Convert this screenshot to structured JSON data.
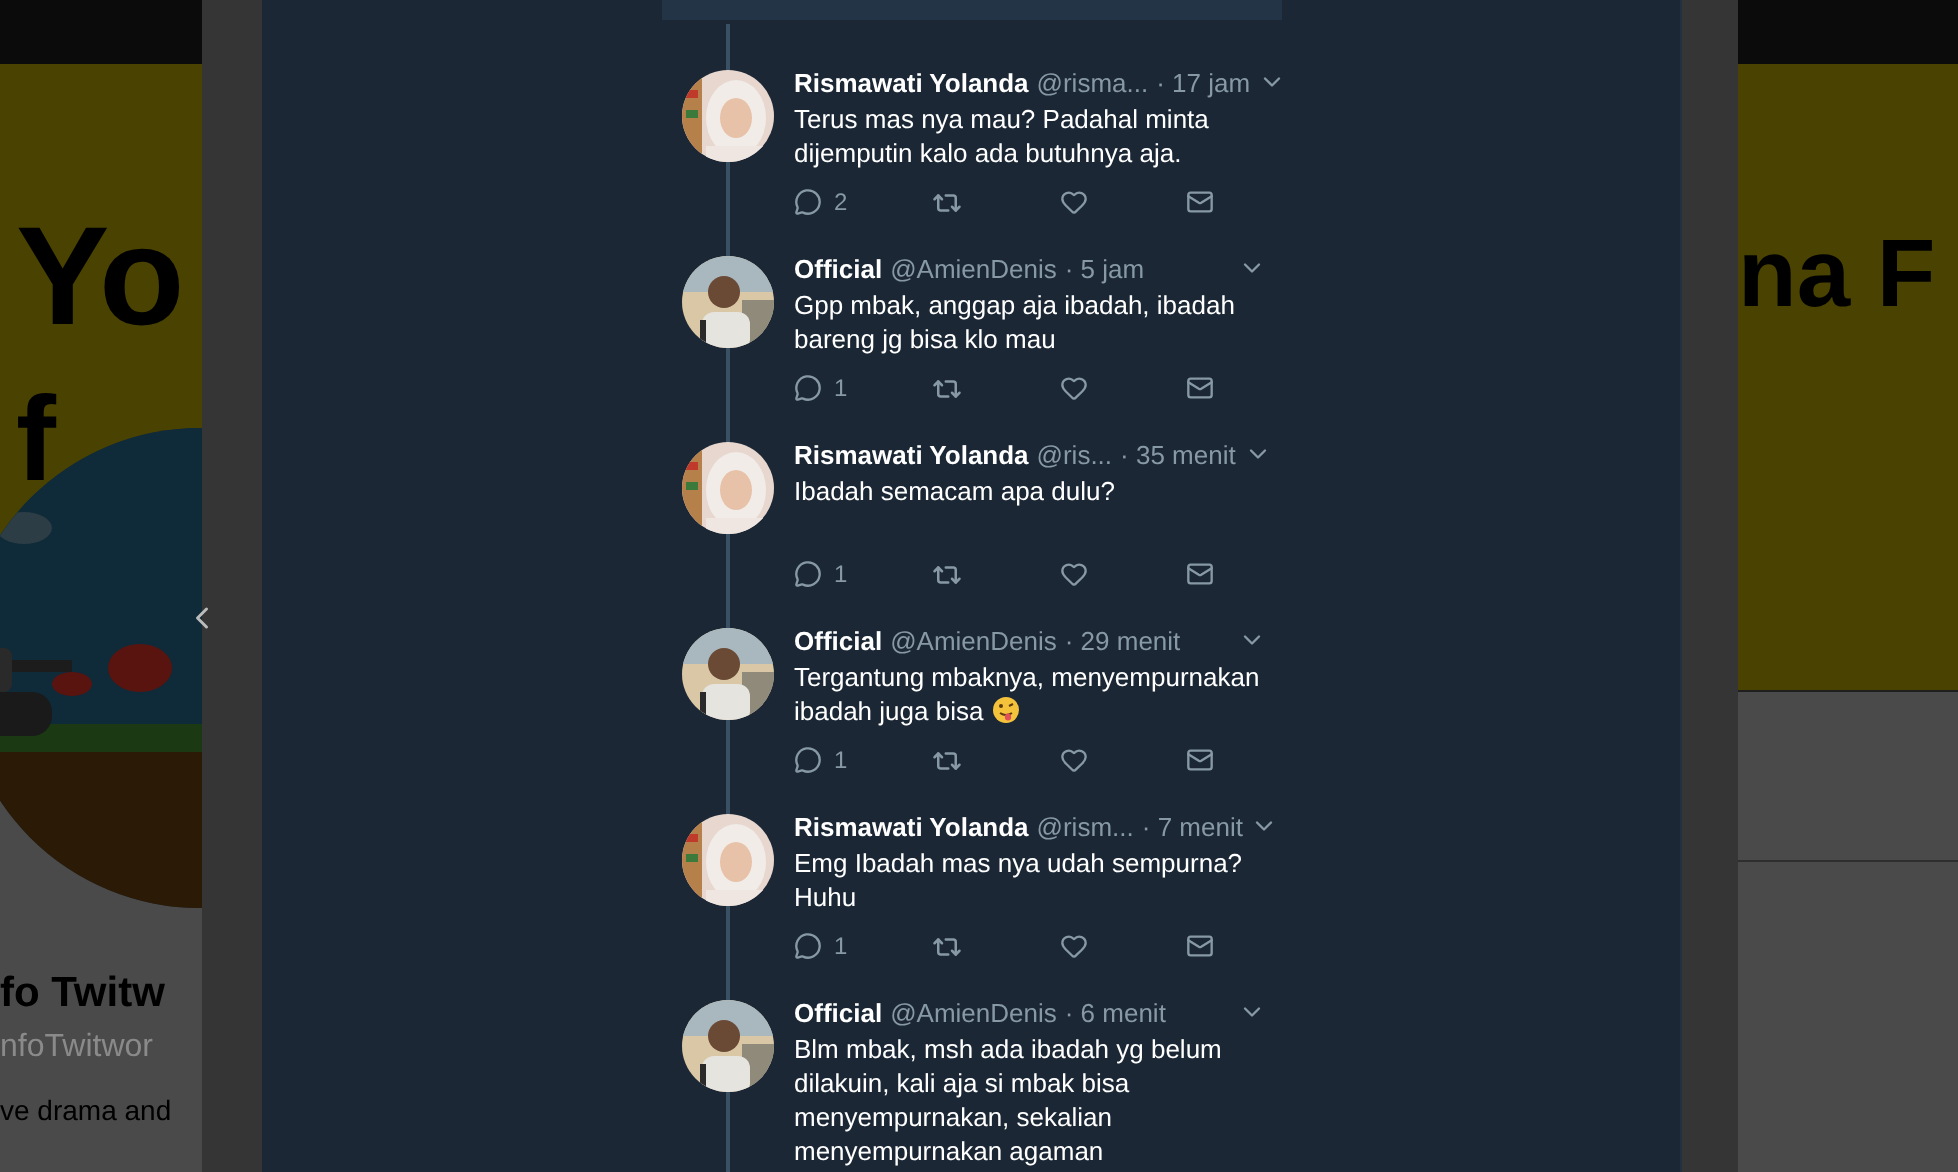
{
  "background_page": {
    "banner_left_text": "Yo",
    "banner_left_text_2": "f",
    "banner_right_text": "na F",
    "profile_name": "fo Twitw",
    "profile_handle": "nfoTwitwor",
    "profile_bio": "ve drama and"
  },
  "tweets": [
    {
      "name": "Rismawati Yolanda",
      "handle": "@risma...",
      "time": "· 17 jam",
      "lines": [
        "Terus mas nya mau? Padahal minta",
        "dijemputin kalo ada butuhnya aja."
      ],
      "emoji": false,
      "reply_count": "2"
    },
    {
      "name": "Official",
      "handle": "@AmienDenis",
      "time": "· 5 jam",
      "lines": [
        "Gpp mbak, anggap aja ibadah, ibadah",
        "bareng jg bisa klo mau"
      ],
      "emoji": false,
      "reply_count": "1"
    },
    {
      "name": "Rismawati Yolanda",
      "handle": "@ris...",
      "time": "· 35 menit",
      "lines": [
        "Ibadah semacam apa dulu?"
      ],
      "emoji": false,
      "reply_count": "1"
    },
    {
      "name": "Official",
      "handle": "@AmienDenis",
      "time": "· 29 menit",
      "lines": [
        "Tergantung mbaknya, menyempurnakan",
        "ibadah juga bisa"
      ],
      "emoji": true,
      "reply_count": "1"
    },
    {
      "name": "Rismawati Yolanda",
      "handle": "@rism...",
      "time": "· 7 menit",
      "lines": [
        "Emg Ibadah mas nya udah sempurna?",
        "Huhu"
      ],
      "emoji": false,
      "reply_count": "1"
    },
    {
      "name": "Official",
      "handle": "@AmienDenis",
      "time": "· 6 menit",
      "lines": [
        "Blm mbak, msh ada ibadah yg belum",
        "dilakuin, kali aja si mbak bisa",
        "menyempurnakan, sekalian",
        "menyempurnakan agaman"
      ],
      "emoji": false
    }
  ]
}
